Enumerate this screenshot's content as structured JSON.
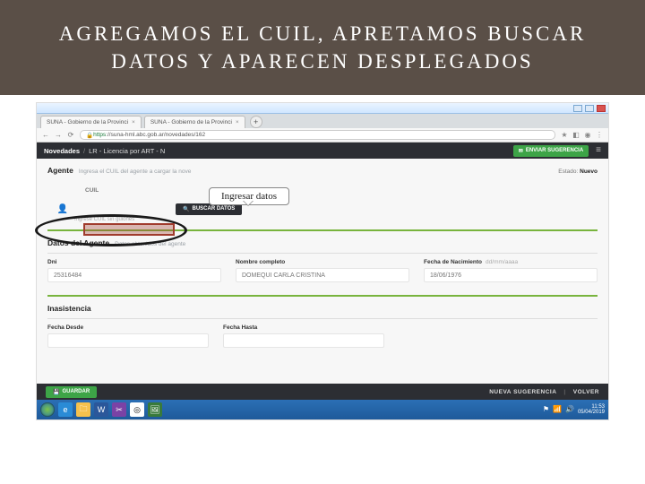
{
  "slide": {
    "title": "AGREGAMOS EL CUIL, APRETAMOS BUSCAR DATOS Y APARECEN DESPLEGADOS"
  },
  "callout": {
    "text": "Ingresar datos"
  },
  "browser": {
    "tabs": [
      {
        "label": "SUNA - Gobierno de la Provinci"
      },
      {
        "label": "SUNA - Gobierno de la Provinci"
      }
    ],
    "url_lock": "https",
    "url_rest": "://suna-hml.abc.gob.ar/novedades/162"
  },
  "app": {
    "breadcrumb_a": "Novedades",
    "breadcrumb_b": "LR - Licencia por ART - N",
    "enviar_sugerencia": "ENVIAR SUGERENCIA",
    "agente_title": "Agente",
    "agente_sub": "Ingresa el CUIL del agente a cargar la nove",
    "estado_label": "Estado:",
    "estado_value": "Nuevo",
    "cuil_label": "CUIL",
    "cuil_hint": "Ingrese CUIL sin guiones",
    "buscar_datos": "BUSCAR DATOS",
    "datos_agente_title": "Datos del Agente",
    "datos_agente_sub": "Datos obtenidos del agente",
    "fields": {
      "dni_label": "Dni",
      "dni_value": "25316484",
      "nombre_label": "Nombre completo",
      "nombre_value": "DOMEQUI CARLA CRISTINA",
      "fnac_label": "Fecha de Nacimiento",
      "fnac_hint": "dd/mm/aaaa",
      "fnac_value": "18/06/1976"
    },
    "inasistencia_title": "Inasistencia",
    "fdesde_label": "Fecha Desde",
    "fhasta_label": "Fecha Hasta",
    "guardar": "GUARDAR",
    "nueva_sugerencia": "NUEVA SUGERENCIA",
    "volver": "VOLVER"
  },
  "taskbar": {
    "time": "11:53",
    "date": "05/04/2019"
  }
}
